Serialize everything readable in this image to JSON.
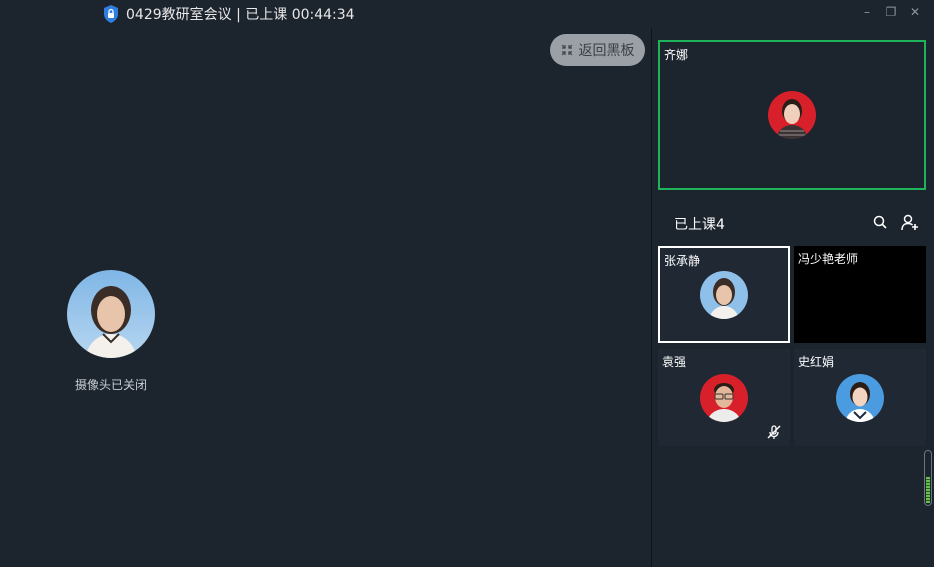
{
  "window": {
    "title": "0429教研室会议 | 已上课 00:44:34",
    "controls": {
      "minimize": "–",
      "restore": "❐",
      "close": "✕"
    }
  },
  "main": {
    "back_label": "返回黑板",
    "camera_status": "摄像头已关闭"
  },
  "teacher": {
    "name": "齐娜",
    "border_color": "#1fb35a"
  },
  "list": {
    "header": "已上课4"
  },
  "students": [
    {
      "name": "张承静",
      "state": "selected"
    },
    {
      "name": "冯少艳老师",
      "state": "black"
    },
    {
      "name": "袁强",
      "state": "muted"
    },
    {
      "name": "史红娟",
      "state": "normal"
    }
  ],
  "icons": {
    "lock": "lock-shield-icon",
    "back": "collapse-icon",
    "search": "search-icon",
    "add_user": "add-user-icon",
    "mute": "mic-muted-icon"
  }
}
